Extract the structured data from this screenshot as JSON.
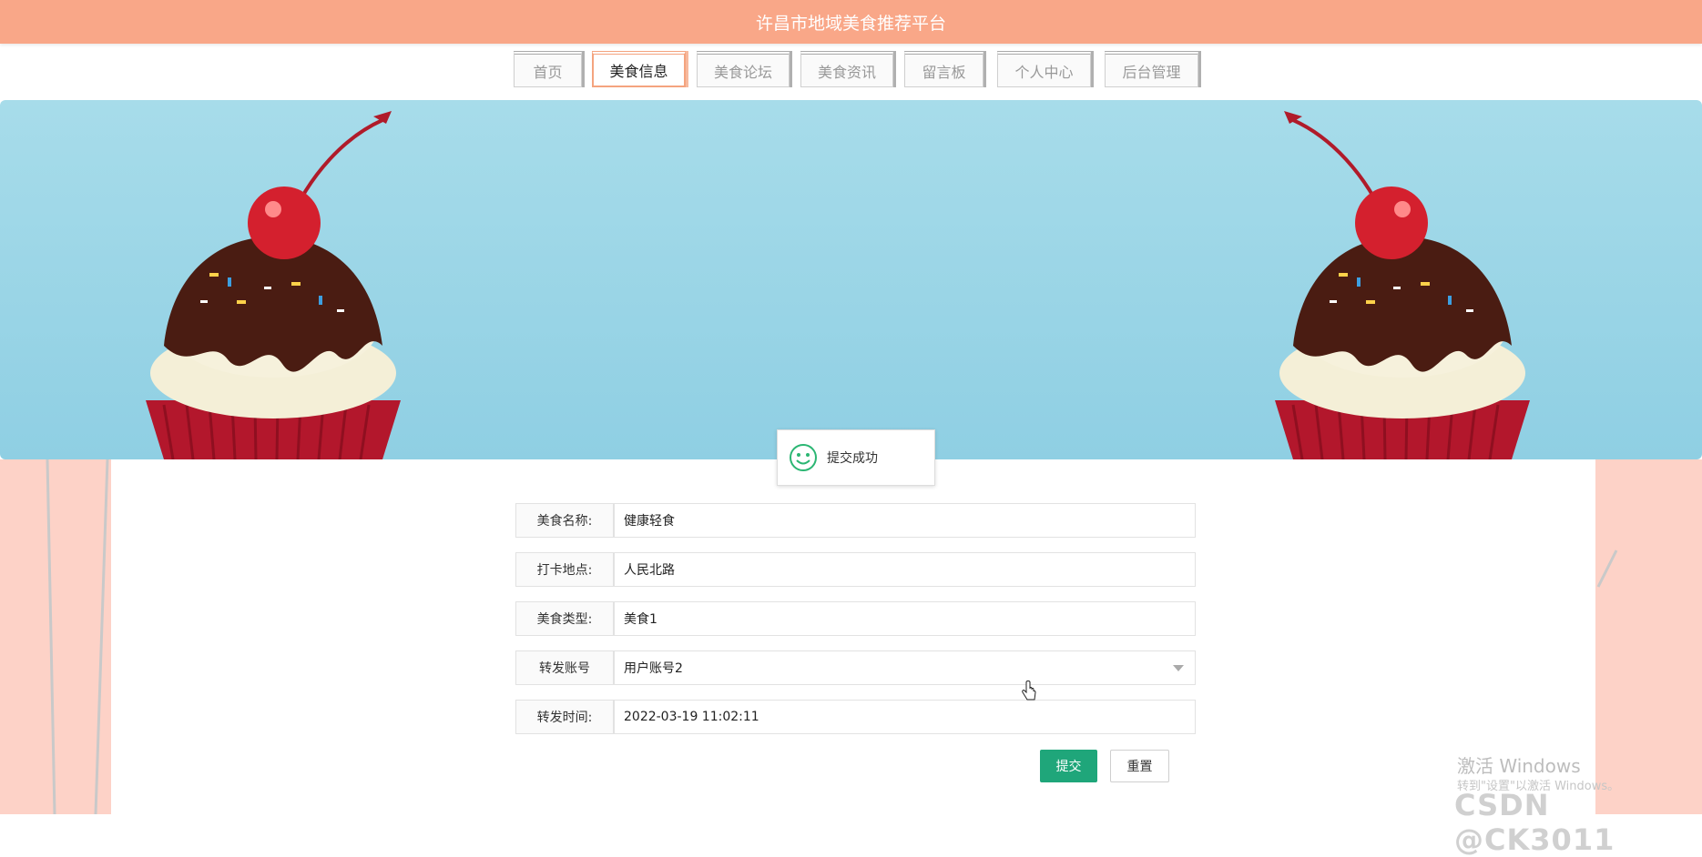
{
  "site": {
    "title": "许昌市地域美食推荐平台"
  },
  "nav": {
    "tabs": [
      {
        "label": "首页"
      },
      {
        "label": "美食信息"
      },
      {
        "label": "美食论坛"
      },
      {
        "label": "美食资讯"
      },
      {
        "label": "留言板"
      },
      {
        "label": "个人中心"
      },
      {
        "label": "后台管理"
      }
    ],
    "active_index": 1
  },
  "toast": {
    "message": "提交成功",
    "icon": "smile-icon"
  },
  "form": {
    "fields": [
      {
        "label": "美食名称:",
        "value": "健康轻食"
      },
      {
        "label": "打卡地点:",
        "value": "人民北路"
      },
      {
        "label": "美食类型:",
        "value": "美食1"
      },
      {
        "label": "转发账号",
        "value": "用户账号2"
      },
      {
        "label": "转发时间:",
        "value": "2022-03-19 11:02:11"
      }
    ],
    "submit_label": "提交",
    "reset_label": "重置"
  },
  "overlay": {
    "activate_title": "激活 Windows",
    "activate_hint": "转到\"设置\"以激活 Windows。",
    "csdn": "CSDN @CK3011"
  },
  "colors": {
    "header": "#f9a788",
    "accent": "#f4a47f",
    "submit": "#1fa67a",
    "banner": "#a7dcea",
    "side": "#fdd2c7"
  }
}
